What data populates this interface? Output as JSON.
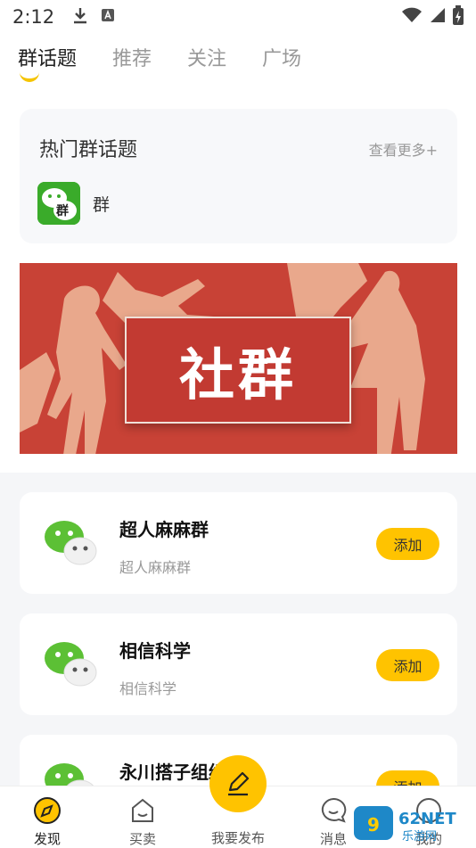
{
  "status_bar": {
    "time": "2:12"
  },
  "tabs": [
    {
      "label": "群话题",
      "active": true
    },
    {
      "label": "推荐",
      "active": false
    },
    {
      "label": "关注",
      "active": false
    },
    {
      "label": "广场",
      "active": false
    }
  ],
  "hot_topics": {
    "title": "热门群话题",
    "more": "查看更多+",
    "item_label": "群",
    "logo_text": "群"
  },
  "banner": {
    "text": "社群"
  },
  "groups": [
    {
      "name": "超人麻麻群",
      "desc": "超人麻麻群",
      "button": "添加"
    },
    {
      "name": "相信科学",
      "desc": "相信科学",
      "button": "添加"
    },
    {
      "name": "永川搭子组织",
      "desc": "",
      "button": "添加"
    }
  ],
  "bottom_nav": {
    "discover": "发现",
    "trade": "买卖",
    "publish": "我要发布",
    "messages": "消息",
    "mine": "我的"
  },
  "watermark": {
    "text": "962NET",
    "subtext": "乐游网"
  },
  "colors": {
    "accent": "#ffc300",
    "banner_red": "#c84236",
    "wechat_green": "#3aab2a"
  }
}
